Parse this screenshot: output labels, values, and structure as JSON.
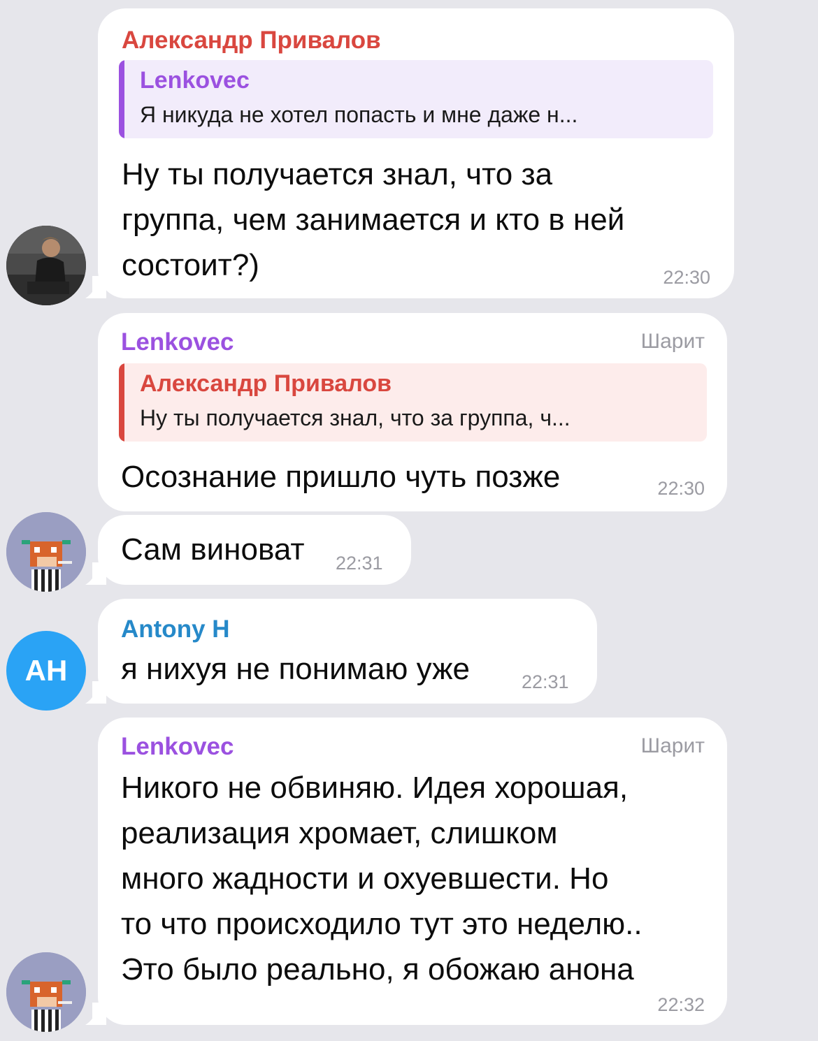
{
  "colors": {
    "background": "#e6e6eb",
    "bubble": "#ffffff",
    "name_red": "#d9473f",
    "name_purple": "#9b51e0",
    "name_blue": "#2689c9",
    "meta_grey": "#9b9ba2",
    "avatar_blue": "#2aa3f5"
  },
  "messages": [
    {
      "sender": "Александр Привалов",
      "reply": {
        "name": "Lenkovec",
        "text": "Я никуда не хотел попасть и мне даже н..."
      },
      "text": "Ну ты получается знал, что за\nгруппа, чем занимается и кто в ней\nсостоит?)",
      "time": "22:30"
    },
    {
      "sender": "Lenkovec",
      "tag": "Шарит",
      "reply": {
        "name": "Александр Привалов",
        "text": "Ну ты получается знал, что за группа, ч..."
      },
      "text": "Осознание пришло чуть позже",
      "time": "22:30"
    },
    {
      "text": "Сам виноват",
      "time": "22:31"
    },
    {
      "sender": "Antony H",
      "text": "я нихуя не понимаю уже",
      "time": "22:31",
      "avatar_initials": "AH"
    },
    {
      "sender": "Lenkovec",
      "tag": "Шарит",
      "text": "Никого не обвиняю. Идея хорошая,\nреализация хромает, слишком\nмного жадности и охуевшести. Но\nто что происходило тут это неделю..\nЭто было реально, я обожаю анона",
      "time": "22:32"
    }
  ]
}
